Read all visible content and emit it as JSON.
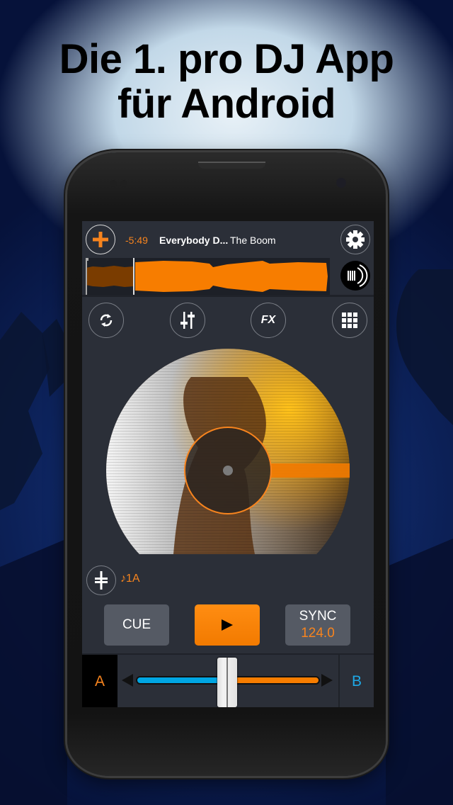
{
  "headline": {
    "line1": "Die 1. pro DJ App",
    "line2": "für Android"
  },
  "deck": {
    "add_icon": "plus-icon",
    "remaining_time": "-5:49",
    "track_title": "Everybody D...",
    "track_artist": "The Boom",
    "settings_icon": "gear-icon",
    "playback_progress": 0.2,
    "scratch_icon": "vinyl-scratch-icon",
    "tools": [
      {
        "name": "loop",
        "icon": "loop-icon"
      },
      {
        "name": "eq",
        "icon": "equalizer-sliders-icon"
      },
      {
        "name": "fx",
        "icon": "fx-icon",
        "label": "FX"
      },
      {
        "name": "sampler",
        "icon": "grid-icon"
      }
    ],
    "pitch_icon": "pitch-fader-icon",
    "key": "♪1A",
    "cue_label": "CUE",
    "play_icon": "play-icon",
    "sync_label": "SYNC",
    "bpm": "124.0"
  },
  "crossfader": {
    "deck_a_label": "A",
    "deck_b_label": "B",
    "position": 0.5
  },
  "colors": {
    "accent_orange": "#f7841e",
    "accent_blue": "#1ea8e6",
    "panel": "#2b2f38"
  }
}
